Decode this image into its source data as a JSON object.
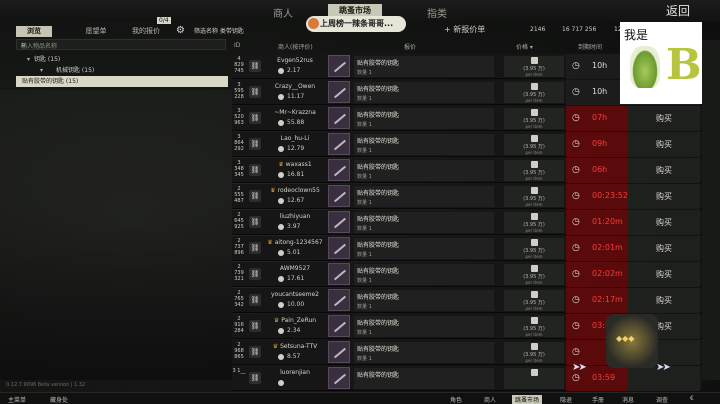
{
  "header": {
    "tabs": [
      {
        "label": "商人"
      },
      {
        "label": "跳蚤市场"
      },
      {
        "label": "指类"
      }
    ],
    "back_label": "返回"
  },
  "notification": {
    "text": "上周榜一辣条哥哥..."
  },
  "left_panel": {
    "tabs": [
      {
        "label": "浏览"
      },
      {
        "label": "愿望单"
      },
      {
        "label": "我的报价"
      }
    ],
    "offers_badge": "0/4",
    "filter_label": "筛选名称 类带钥匙",
    "search_placeholder": "输入物品名称",
    "tree": [
      {
        "label": "钥匙 (15)"
      },
      {
        "label": "机械钥匙 (15)"
      },
      {
        "label": "贴有胶带的钥匙 (15)"
      }
    ]
  },
  "subbar": {
    "new_offer": "+ 新报价单",
    "rubles": "2146",
    "euros": "16 717 256",
    "usd": "126 1021"
  },
  "table_header": {
    "id": "ID",
    "trader": "商人(按评价)",
    "offer": "报价",
    "price": "价格 ▾",
    "expire": "到期时间"
  },
  "rows": [
    {
      "id": "4 829 745",
      "trader": "Evgen52rus",
      "crown": false,
      "rating": "2.17",
      "item": "贴有胶带的钥匙",
      "qty": "数量 1",
      "price": "(3.95 万)",
      "unit": "per item",
      "time": "10h",
      "warn": false,
      "buy": ""
    },
    {
      "id": "3 595 228",
      "trader": "Crazy__Owen",
      "crown": false,
      "rating": "11.17",
      "item": "贴有胶带的钥匙",
      "qty": "数量 1",
      "price": "(3.95 万)",
      "unit": "per item",
      "time": "10h",
      "warn": false,
      "buy": ""
    },
    {
      "id": "3 520 963",
      "trader": "~Mr~Krazzna",
      "crown": false,
      "rating": "55.88",
      "item": "贴有胶带的钥匙",
      "qty": "数量 1",
      "price": "(3.95 万)",
      "unit": "per item",
      "time": "07h",
      "warn": true,
      "buy": "购买"
    },
    {
      "id": "3 864 292",
      "trader": "Lao_hu-Li",
      "crown": false,
      "rating": "12.79",
      "item": "贴有胶带的钥匙",
      "qty": "数量 1",
      "price": "(3.95 万)",
      "unit": "per item",
      "time": "09h",
      "warn": true,
      "buy": "购买"
    },
    {
      "id": "3 348 345",
      "trader": "waxass1",
      "crown": true,
      "rating": "16.81",
      "item": "贴有胶带的钥匙",
      "qty": "数量 1",
      "price": "(3.95 万)",
      "unit": "per item",
      "time": "06h",
      "warn": true,
      "buy": "购买"
    },
    {
      "id": "2 555 487",
      "trader": "rodeoclown55",
      "crown": true,
      "rating": "12.67",
      "item": "贴有胶带的钥匙",
      "qty": "数量 1",
      "price": "(3.95 万)",
      "unit": "per item",
      "time": "00:23:52",
      "warn": true,
      "buy": "购买"
    },
    {
      "id": "2 645 925",
      "trader": "liuzhiyuan",
      "crown": false,
      "rating": "3.97",
      "item": "贴有胶带的钥匙",
      "qty": "数量 1",
      "price": "(3.95 万)",
      "unit": "per item",
      "time": "01:20m",
      "warn": true,
      "buy": "购买"
    },
    {
      "id": "2 737 896",
      "trader": "aitong-1234567",
      "crown": true,
      "rating": "5.01",
      "item": "贴有胶带的钥匙",
      "qty": "数量 1",
      "price": "(3.95 万)",
      "unit": "per item",
      "time": "02:01m",
      "warn": true,
      "buy": "购买"
    },
    {
      "id": "2 739 321",
      "trader": "AWM9527",
      "crown": false,
      "rating": "17.61",
      "item": "贴有胶带的钥匙",
      "qty": "数量 1",
      "price": "(3.95 万)",
      "unit": "per item",
      "time": "02:02m",
      "warn": true,
      "buy": "购买"
    },
    {
      "id": "2 765 342",
      "trader": "youcantseeme2",
      "crown": false,
      "rating": "10.00",
      "item": "贴有胶带的钥匙",
      "qty": "数量 1",
      "price": "(3.95 万)",
      "unit": "per item",
      "time": "02:17m",
      "warn": true,
      "buy": "购买"
    },
    {
      "id": "2 916 284",
      "trader": "Pain_ZeRun",
      "crown": true,
      "rating": "2.34",
      "item": "贴有胶带的钥匙",
      "qty": "数量 1",
      "price": "(3.95 万)",
      "unit": "per item",
      "time": "03:16m",
      "warn": true,
      "buy": "购买"
    },
    {
      "id": "2 968 865",
      "trader": "Setsuna-TTV",
      "crown": true,
      "rating": "8.57",
      "item": "贴有胶带的钥匙",
      "qty": "数量 1",
      "price": "(3.95 万)",
      "unit": "per item",
      "time": "",
      "warn": true,
      "buy": ""
    },
    {
      "id": "3 1__",
      "trader": "luorenjian",
      "crown": false,
      "rating": "",
      "item": "贴有胶带的钥匙",
      "qty": "",
      "price": "",
      "unit": "",
      "time": "03:59",
      "warn": true,
      "buy": ""
    }
  ],
  "watermark": {
    "text": "我是",
    "letter": "B"
  },
  "bottom_bar": {
    "main": "主菜单",
    "hideout": "藏身处",
    "character": "角色",
    "traders": "商人",
    "flea": "跳蚤市场",
    "hideout2": "隐退",
    "handbook": "手册",
    "messages": "消息",
    "survey": "调查",
    "eur": "€"
  },
  "version": "0.12.7.9096 Beta version | 1.32"
}
